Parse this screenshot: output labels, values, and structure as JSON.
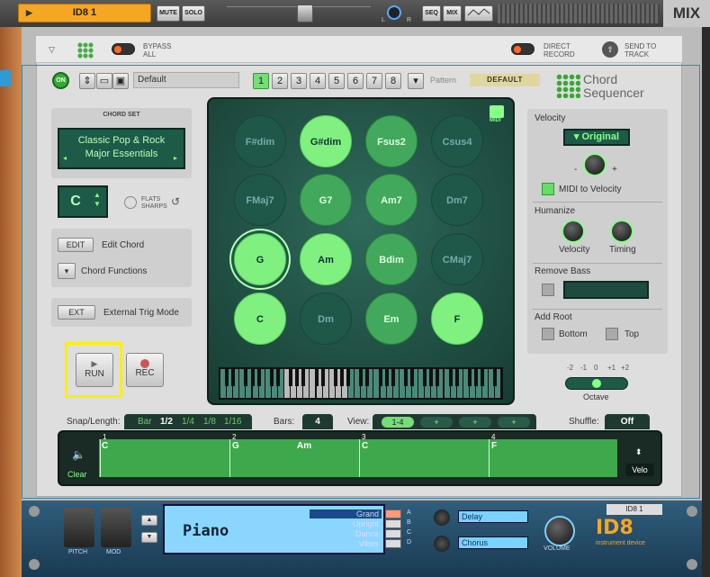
{
  "topbar": {
    "track_name": "ID8 1",
    "mute": "MUTE",
    "solo": "SOLO",
    "seq": "SEQ",
    "mix_btn": "MIX",
    "mix_label": "MIX",
    "l": "L",
    "r": "R"
  },
  "header": {
    "bypass": "BYPASS",
    "all": "ALL",
    "direct": "DIRECT",
    "record": "RECORD",
    "send": "SEND TO",
    "track": "TRACK"
  },
  "toolbar": {
    "on": "ON",
    "preset": "Default",
    "patterns": [
      "1",
      "2",
      "3",
      "4",
      "5",
      "6",
      "7",
      "8"
    ],
    "pattern_label": "Pattern",
    "pattern_value": "DEFAULT",
    "logo_line1": "Chord",
    "logo_line2": "Sequencer"
  },
  "chord_set": {
    "title": "CHORD SET",
    "line1": "Classic Pop & Rock",
    "line2": "Major Essentials",
    "key": "C",
    "flats": "FLATS",
    "sharps": "SHARPS"
  },
  "edit": {
    "edit_btn": "EDIT",
    "edit_label": "Edit Chord",
    "functions_label": "Chord Functions",
    "ext_btn": "EXT",
    "ext_label": "External Trig Mode"
  },
  "transport": {
    "run": "RUN",
    "rec": "REC"
  },
  "pads": [
    "F#dim",
    "G#dim",
    "Fsus2",
    "Csus4",
    "FMaj7",
    "G7",
    "Am7",
    "Dm7",
    "G",
    "Am",
    "Bdim",
    "CMaj7",
    "C",
    "Dm",
    "Em",
    "F"
  ],
  "midi": "MIDI",
  "right": {
    "velocity": "Velocity",
    "original": "Original",
    "minus": "-",
    "plus": "+",
    "midi_to_vel": "MIDI to Velocity",
    "humanize": "Humanize",
    "hum_vel": "Velocity",
    "hum_timing": "Timing",
    "remove_bass": "Remove Bass",
    "add_root": "Add Root",
    "bottom": "Bottom",
    "top": "Top",
    "octave_ticks": [
      "-2",
      "-1",
      "0",
      "+1",
      "+2"
    ],
    "octave": "Octave"
  },
  "seqbar": {
    "snap_label": "Snap/Length:",
    "snap_opts": [
      "Bar",
      "1/2",
      "1/4",
      "1/8",
      "1/16"
    ],
    "bars_label": "Bars:",
    "bars_value": "4",
    "view_label": "View:",
    "view_opts": [
      "1-4",
      "+",
      "+",
      "+"
    ],
    "shuffle_label": "Shuffle:",
    "shuffle_value": "Off",
    "clear": "Clear",
    "velo": "Velo",
    "bar_nums": [
      "1",
      "2",
      "3",
      "4"
    ],
    "chords": [
      "C",
      "G",
      "Am",
      "C",
      "F"
    ]
  },
  "instrument": {
    "pitch": "PITCH",
    "mod": "MOD",
    "patch": "Piano",
    "slots": [
      "Grand",
      "Upright",
      "Dance",
      "Vibes"
    ],
    "slot_letters": [
      "A",
      "B",
      "C",
      "D"
    ],
    "fx1": "Delay",
    "fx2": "Chorus",
    "volume": "VOLUME",
    "name_tag": "ID8 1",
    "brand": "ID8",
    "brand_sub": "instrument device"
  }
}
